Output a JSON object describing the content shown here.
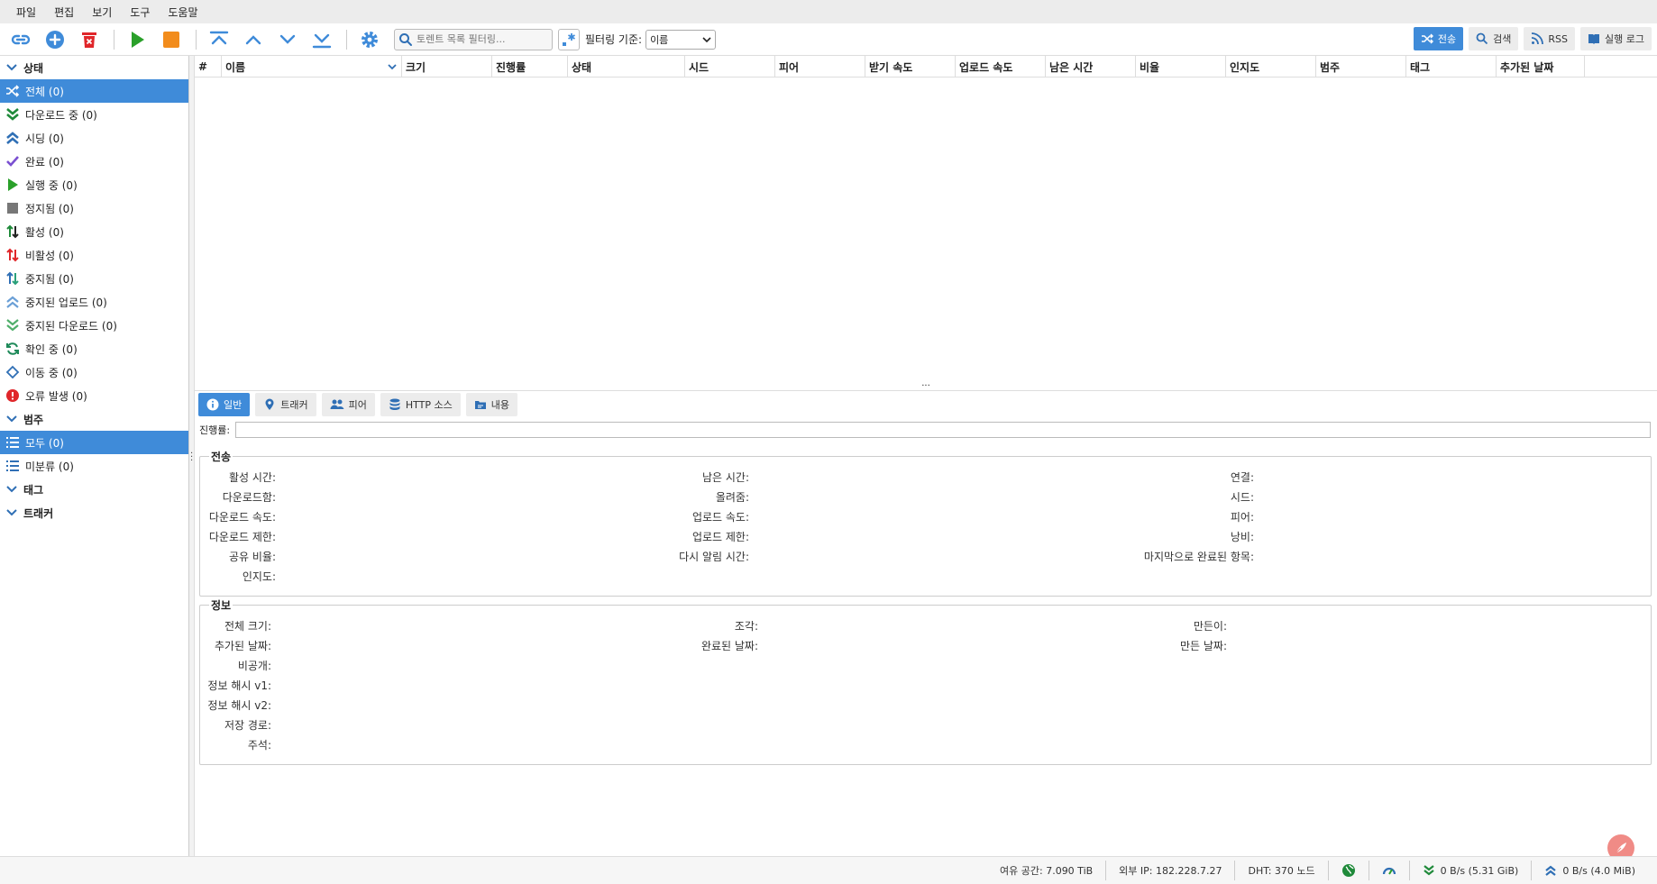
{
  "menu": [
    "파일",
    "편집",
    "보기",
    "도구",
    "도움말"
  ],
  "toolbar": {
    "search_placeholder": "토렌트 목록 필터링...",
    "filter_label": "필터링 기준:",
    "filter_value": "이름",
    "right_tabs": [
      {
        "label": "전송",
        "icon": "shuffle-icon",
        "active": true
      },
      {
        "label": "검색",
        "icon": "magnifier-icon",
        "active": false
      },
      {
        "label": "RSS",
        "icon": "rss-icon",
        "active": false
      },
      {
        "label": "실행 로그",
        "icon": "book-icon",
        "active": false
      }
    ]
  },
  "sidebar": {
    "status_header": "상태",
    "status_items": [
      {
        "label": "전체 (0)",
        "icon": "shuffle-icon",
        "active": true
      },
      {
        "label": "다운로드 중 (0)",
        "icon": "double-down-icon",
        "active": false
      },
      {
        "label": "시딩 (0)",
        "icon": "double-up-icon",
        "active": false
      },
      {
        "label": "완료 (0)",
        "icon": "check-icon",
        "active": false
      },
      {
        "label": "실행 중 (0)",
        "icon": "play-icon",
        "active": false
      },
      {
        "label": "정지됨 (0)",
        "icon": "stop-icon",
        "active": false
      },
      {
        "label": "활성 (0)",
        "icon": "updown-arrows-icon",
        "active": false
      },
      {
        "label": "비활성 (0)",
        "icon": "updown-red-arrows-icon",
        "active": false
      },
      {
        "label": "중지됨 (0)",
        "icon": "updown-teal-arrows-icon",
        "active": false
      },
      {
        "label": "중지된 업로드 (0)",
        "icon": "stalled-upload-icon",
        "active": false
      },
      {
        "label": "중지된 다운로드 (0)",
        "icon": "stalled-download-icon",
        "active": false
      },
      {
        "label": "확인 중 (0)",
        "icon": "refresh-icon",
        "active": false
      },
      {
        "label": "이동 중 (0)",
        "icon": "diamond-icon",
        "active": false
      },
      {
        "label": "오류 발생 (0)",
        "icon": "error-icon",
        "active": false
      }
    ],
    "category_header": "범주",
    "category_items": [
      {
        "label": "모두 (0)",
        "icon": "list-icon",
        "active": true
      },
      {
        "label": "미분류 (0)",
        "icon": "list-icon",
        "active": false
      }
    ],
    "tag_header": "태그",
    "tracker_header": "트래커"
  },
  "table": {
    "columns": [
      "#",
      "이름",
      "크기",
      "진행률",
      "상태",
      "시드",
      "피어",
      "받기 속도",
      "업로드 속도",
      "남은 시간",
      "비율",
      "인지도",
      "범주",
      "태그",
      "추가된 날짜"
    ]
  },
  "props": {
    "tabs": [
      {
        "label": "일반",
        "icon": "info-icon",
        "active": true
      },
      {
        "label": "트래커",
        "icon": "pin-icon",
        "active": false
      },
      {
        "label": "피어",
        "icon": "people-icon",
        "active": false
      },
      {
        "label": "HTTP 소스",
        "icon": "database-icon",
        "active": false
      },
      {
        "label": "내용",
        "icon": "folder-icon",
        "active": false
      }
    ],
    "progress_label": "진행률:",
    "transfer_title": "전송",
    "transfer_col1": [
      "활성 시간:",
      "다운로드함:",
      "다운로드 속도:",
      "다운로드 제한:",
      "공유 비율:",
      "인지도:"
    ],
    "transfer_col2": [
      "남은 시간:",
      "올려줌:",
      "업로드 속도:",
      "업로드 제한:",
      "다시 알림 시간:"
    ],
    "transfer_col3": [
      "연결:",
      "시드:",
      "피어:",
      "낭비:",
      "마지막으로 완료된 항목:"
    ],
    "info_title": "정보",
    "info_col1": [
      "전체 크기:",
      "추가된 날짜:",
      "비공개:",
      "정보 해시 v1:",
      "정보 해시 v2:",
      "저장 경로:",
      "주석:"
    ],
    "info_col2": [
      "조각:",
      "완료된 날짜:"
    ],
    "info_col3": [
      "만든이:",
      "만든 날짜:"
    ]
  },
  "statusbar": {
    "free_space": "여유 공간: 7.090 TiB",
    "external_ip": "외부 IP: 182.228.7.27",
    "dht": "DHT: 370 노드",
    "download": "0 B/s (5.31 GiB)",
    "upload": "0 B/s (4.0 MiB)"
  },
  "colors": {
    "accent": "#3f8bd9",
    "green": "#2aa02a",
    "orange": "#f28c1c",
    "red": "#e0262a"
  }
}
